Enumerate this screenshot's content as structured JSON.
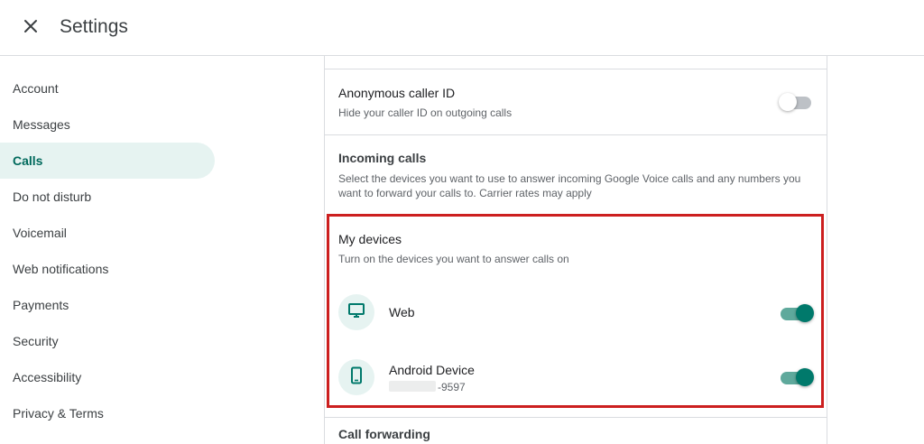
{
  "header": {
    "title": "Settings",
    "close_icon": "close-icon"
  },
  "sidebar": {
    "items": [
      {
        "label": "Account",
        "active": false
      },
      {
        "label": "Messages",
        "active": false
      },
      {
        "label": "Calls",
        "active": true
      },
      {
        "label": "Do not disturb",
        "active": false
      },
      {
        "label": "Voicemail",
        "active": false
      },
      {
        "label": "Web notifications",
        "active": false
      },
      {
        "label": "Payments",
        "active": false
      },
      {
        "label": "Security",
        "active": false
      },
      {
        "label": "Accessibility",
        "active": false
      },
      {
        "label": "Privacy & Terms",
        "active": false
      }
    ]
  },
  "calls": {
    "anonymous": {
      "title": "Anonymous caller ID",
      "description": "Hide your caller ID on outgoing calls",
      "enabled": false
    },
    "incoming": {
      "title": "Incoming calls",
      "description": "Select the devices you want to use to answer incoming Google Voice calls and any numbers you want to forward your calls to. Carrier rates may apply"
    },
    "my_devices": {
      "title": "My devices",
      "description": "Turn on the devices you want to answer calls on",
      "devices": [
        {
          "name": "Web",
          "icon": "monitor-icon",
          "enabled": true
        },
        {
          "name": "Android Device",
          "number": "-9597",
          "icon": "smartphone-icon",
          "enabled": true
        }
      ]
    },
    "call_forwarding": {
      "title": "Call forwarding"
    }
  },
  "colors": {
    "accent": "#00796b",
    "active_nav_bg": "#e6f3f1",
    "highlight_border": "#cc1f1f"
  }
}
